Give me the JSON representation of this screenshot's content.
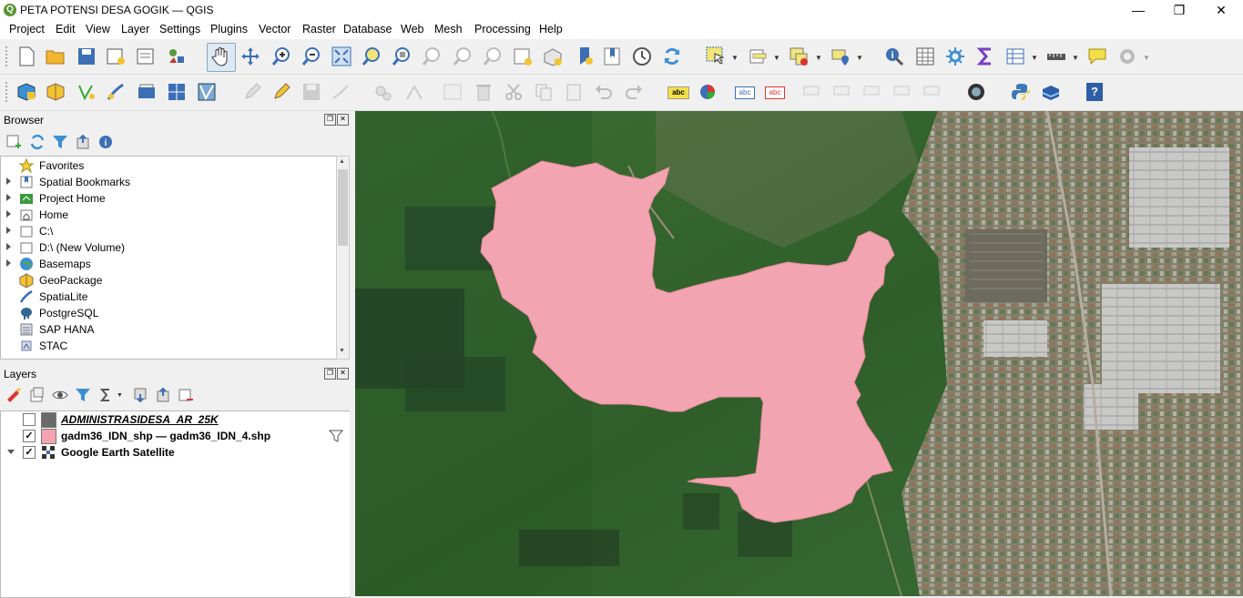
{
  "window": {
    "title": "PETA POTENSI DESA GOGIK — QGIS",
    "logo_letter": "Q"
  },
  "window_controls": {
    "minimize": "—",
    "maximize": "❐",
    "close": "✕"
  },
  "menu": [
    "Project",
    "Edit",
    "View",
    "Layer",
    "Settings",
    "Plugins",
    "Vector",
    "Raster",
    "Database",
    "Web",
    "Mesh",
    "Processing",
    "Help"
  ],
  "toolbar_icons": {
    "labels": {
      "abc1": "abc",
      "abc2": "abc",
      "abc3": "abc",
      "help": "?"
    }
  },
  "browser": {
    "title": "Browser",
    "items": [
      {
        "label": "Favorites",
        "expandable": false
      },
      {
        "label": "Spatial Bookmarks",
        "expandable": true
      },
      {
        "label": "Project Home",
        "expandable": true
      },
      {
        "label": "Home",
        "expandable": true
      },
      {
        "label": "C:\\",
        "expandable": true
      },
      {
        "label": "D:\\ (New Volume)",
        "expandable": true
      },
      {
        "label": "Basemaps",
        "expandable": true
      },
      {
        "label": "GeoPackage",
        "expandable": false
      },
      {
        "label": "SpatiaLite",
        "expandable": false
      },
      {
        "label": "PostgreSQL",
        "expandable": false
      },
      {
        "label": "SAP HANA",
        "expandable": false
      },
      {
        "label": "STAC",
        "expandable": false
      }
    ]
  },
  "layers": {
    "title": "Layers",
    "items": [
      {
        "label": "ADMINISTRASIDESA_AR_25K",
        "checked": false,
        "symbol_color": "#6b6b6b"
      },
      {
        "label": "gadm36_IDN_shp — gadm36_IDN_4.shp",
        "checked": true,
        "symbol_color": "#f4a3b0"
      },
      {
        "label": "Google Earth Satellite",
        "checked": true,
        "symbol_color": "#333333"
      }
    ]
  },
  "colors": {
    "polygon_fill": "#f3a4b1",
    "vegetation": "#2f5e2a",
    "urban": "#9b8d80"
  }
}
